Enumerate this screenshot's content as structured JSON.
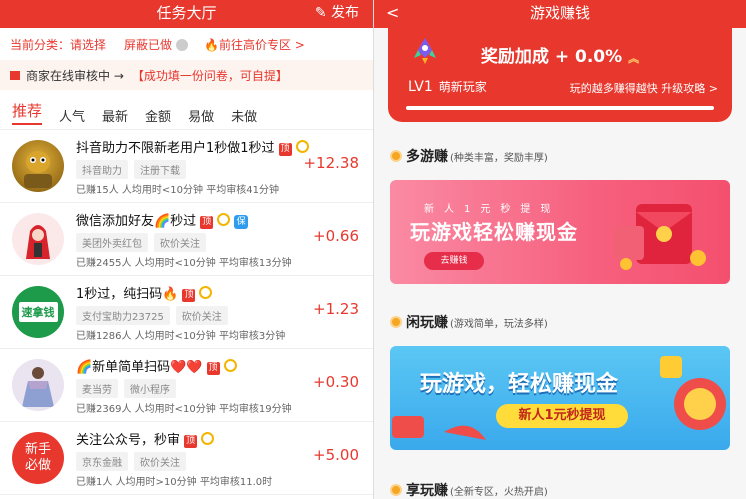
{
  "left": {
    "header": {
      "title": "任务大厅",
      "publish_label": "发布"
    },
    "category_bar": {
      "current": "当前分类：请选择",
      "block": "屏蔽已做",
      "premium": "前往高价专区 >"
    },
    "notice": {
      "text": "商家在线审核中 →",
      "highlight": "【成功填一份问卷，可自提】"
    },
    "tabs": [
      "推荐",
      "人气",
      "最新",
      "金额",
      "易做",
      "未做"
    ],
    "tasks": [
      {
        "title": "抖音助力不限新老用户1秒做1秒过",
        "badges": [
          "顶"
        ],
        "chips": [
          "抖音助力",
          "注册下载"
        ],
        "earned": "已赚15人",
        "time": "人均用时<10分钟",
        "review": "平均审核41分钟",
        "amount": "+12.38"
      },
      {
        "title": "微信添加好友🌈秒过",
        "badges": [
          "顶",
          "保"
        ],
        "chips": [
          "美团外卖红包",
          "砍价关注"
        ],
        "earned": "已赚2455人",
        "time": "人均用时<10分钟",
        "review": "平均审核13分钟",
        "amount": "+0.66"
      },
      {
        "title": "1秒过，纯扫码🔥",
        "badges": [
          "顶"
        ],
        "chips": [
          "支付宝助力23725",
          "砍价关注"
        ],
        "earned": "已赚1286人",
        "time": "人均用时<10分钟",
        "review": "平均审核3分钟",
        "amount": "+1.23"
      },
      {
        "title": "🌈新单简单扫码❤️❤️",
        "badges": [
          "顶"
        ],
        "chips": [
          "麦当劳",
          "微小程序"
        ],
        "earned": "已赚2369人",
        "time": "人均用时<10分钟",
        "review": "平均审核19分钟",
        "amount": "+0.30"
      },
      {
        "title": "关注公众号，秒审",
        "badges": [
          "顶"
        ],
        "chips": [
          "京东金融",
          "砍价关注"
        ],
        "earned": "已赚1人",
        "time": "人均用时>10分钟",
        "review": "平均审核11.0时",
        "amount": "+5.00"
      }
    ],
    "avatar_texts": {
      "scan": "速拿钱",
      "newbie": "新手必做"
    }
  },
  "right": {
    "header": {
      "back": "<",
      "title": "游戏赚钱"
    },
    "card": {
      "bonus": "奖励加成 + 0.0%",
      "level": "LV1",
      "level_name": "萌新玩家",
      "tip": "玩的越多赚得越快 升级攻略 >"
    },
    "sections": [
      {
        "title": "多游赚",
        "sub": "(种类丰富，奖励丰厚)"
      },
      {
        "title": "闲玩赚",
        "sub": "(游戏简单，玩法多样)"
      },
      {
        "title": "享玩赚",
        "sub": "(全新专区，火热开启)"
      }
    ],
    "banner1": {
      "small": "新人1元秒提现",
      "big": "玩游戏轻松赚现金",
      "button": "去赚钱"
    },
    "banner2": {
      "big": "玩游戏，轻松赚现金",
      "pill": "新人1元秒提现"
    }
  },
  "colors": {
    "accent": "#e8382e",
    "premium_gold": "#f3b500"
  }
}
